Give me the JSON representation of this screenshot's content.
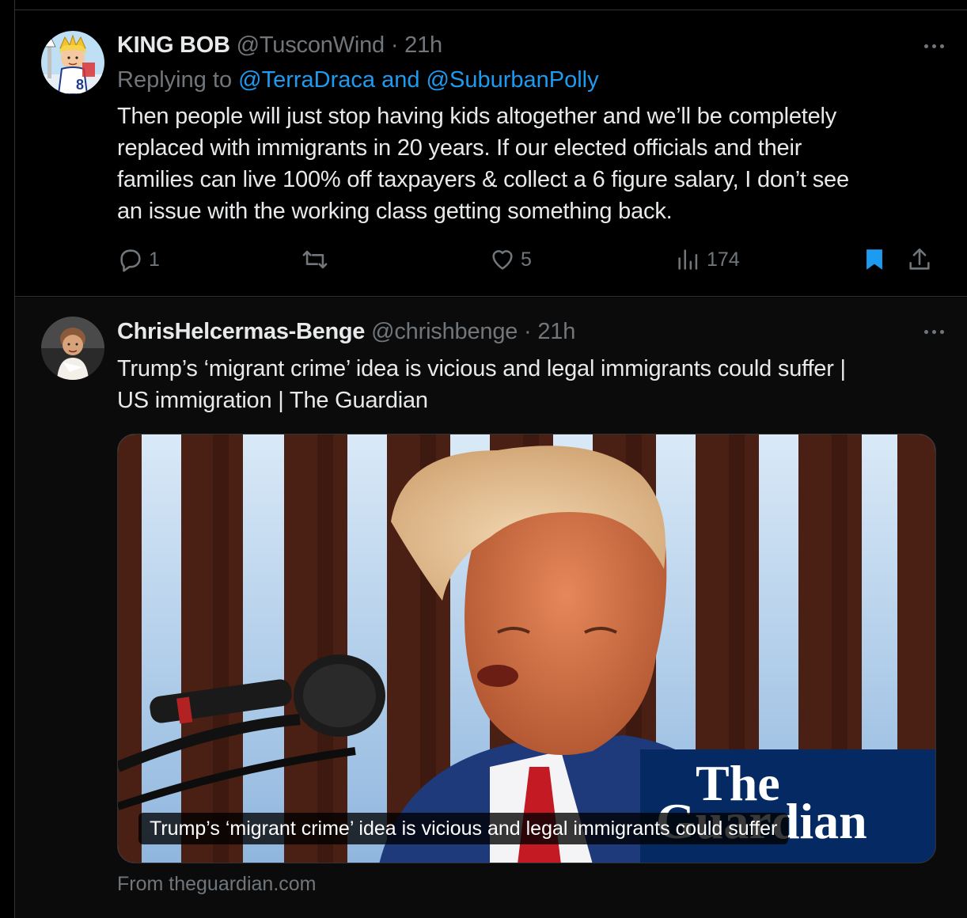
{
  "tweets": [
    {
      "author_name": "KING BOB",
      "author_handle": "@TusconWind",
      "separator": "·",
      "time": "21h",
      "replying_prefix": "Replying to",
      "reply_to_1": "@TerraDraca",
      "reply_joiner": "and",
      "reply_to_2": "@SuburbanPolly",
      "text_lines": [
        "Then people will just stop having kids altogether and we’ll be completely",
        "replaced with immigrants in 20 years. If our elected officials and their",
        "families can live 100% off taxpayers & collect a 6 figure salary, I don’t see",
        "an issue with the working class getting something back."
      ],
      "counts": {
        "replies": "1",
        "retweets": "",
        "likes": "5",
        "views": "174"
      },
      "bookmarked": true
    },
    {
      "author_name": "ChrisHelcermas-Benge",
      "author_handle": "@chrishbenge",
      "separator": "·",
      "time": "21h",
      "text_lines": [
        "Trump’s ‘migrant crime’ idea is vicious and legal immigrants could suffer |",
        "US immigration | The Guardian"
      ],
      "card": {
        "caption": "Trump’s ‘migrant crime’ idea is vicious and legal immigrants could suffer",
        "logo_line1": "The",
        "logo_line2": "Guardian",
        "source": "From theguardian.com"
      }
    }
  ],
  "colors": {
    "background": "#000000",
    "text": "#e7e9ea",
    "secondary_text": "#71767b",
    "link": "#1d9bf0",
    "border": "#2f3336",
    "bookmark_active": "#1d9bf0",
    "guardian_blue": "#052962"
  },
  "icons": {
    "reply": "reply-icon",
    "retweet": "retweet-icon",
    "like": "heart-icon",
    "views": "views-chart-icon",
    "bookmark": "bookmark-icon",
    "share": "share-icon",
    "more": "more-dots-icon"
  }
}
